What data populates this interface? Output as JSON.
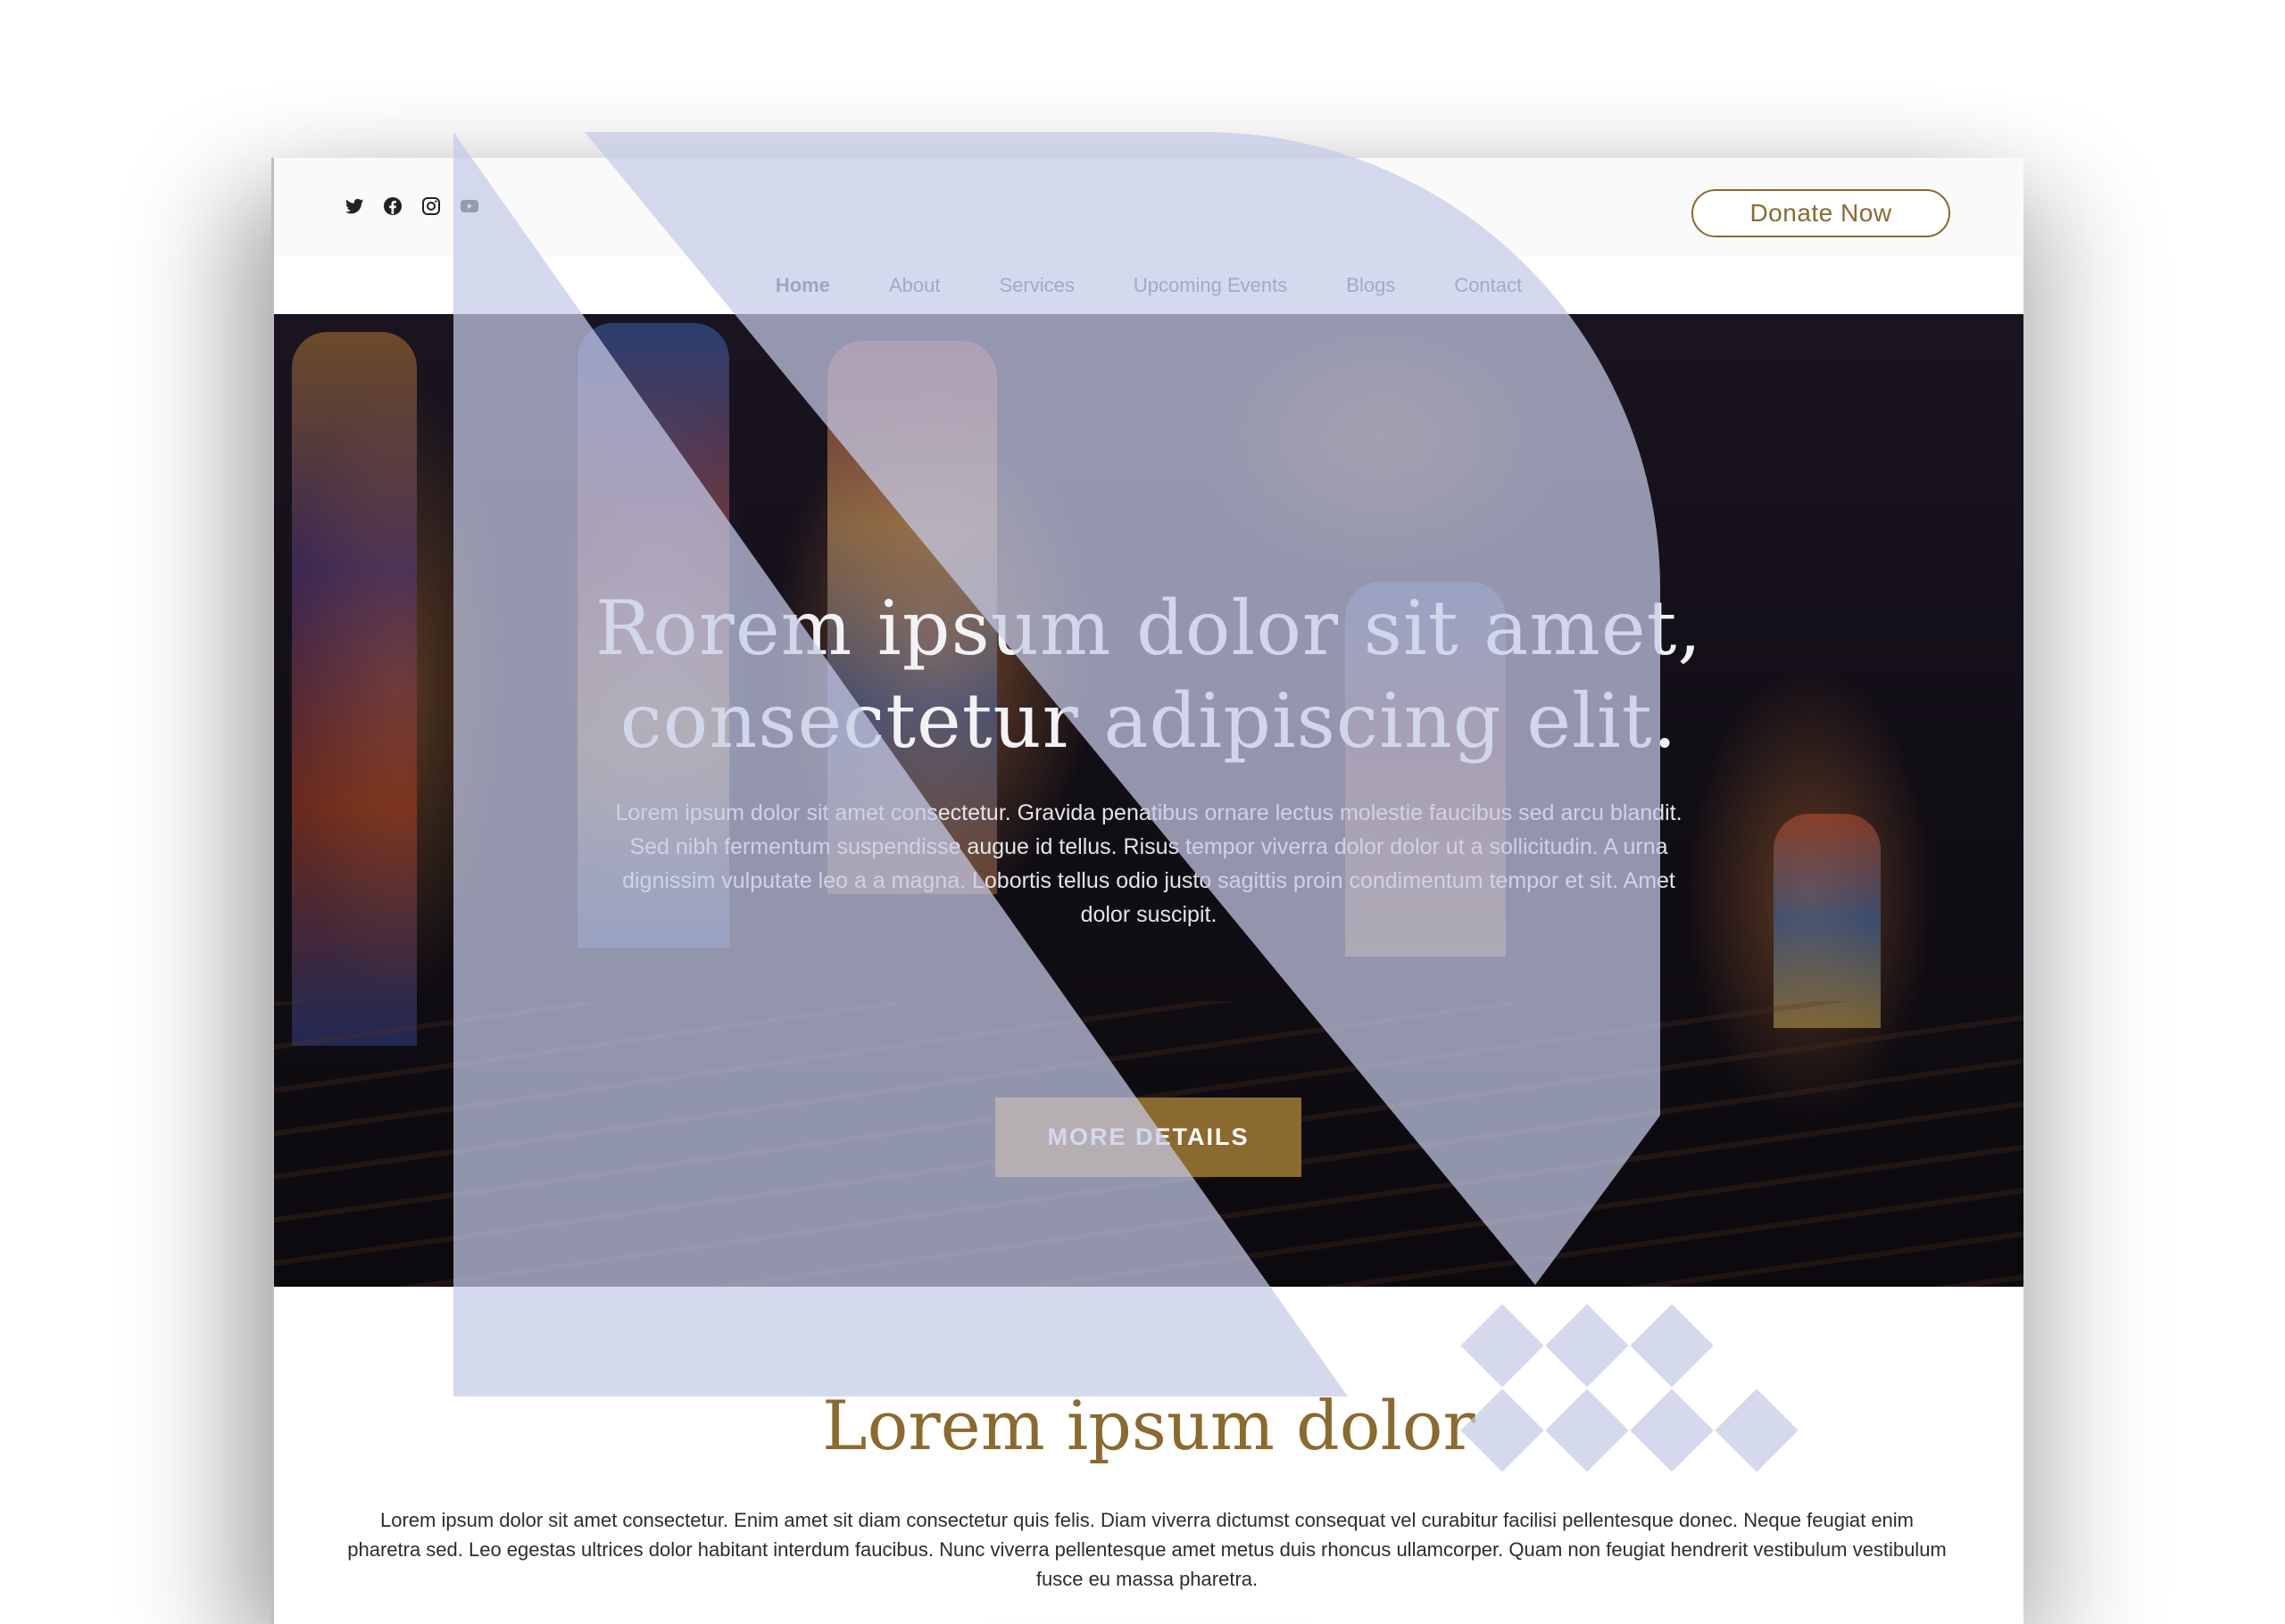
{
  "topbar": {
    "social_icons": [
      "twitter-icon",
      "facebook-icon",
      "instagram-icon",
      "youtube-icon"
    ],
    "donate_label": "Donate Now"
  },
  "nav": {
    "items": [
      {
        "label": "Home",
        "active": true
      },
      {
        "label": "About"
      },
      {
        "label": "Services"
      },
      {
        "label": "Upcoming Events"
      },
      {
        "label": "Blogs"
      },
      {
        "label": "Contact"
      }
    ]
  },
  "hero": {
    "title_line1": "Rorem ipsum dolor sit amet,",
    "title_line2": "consectetur adipiscing elit.",
    "text": "Lorem ipsum dolor sit amet consectetur. Gravida penatibus ornare lectus molestie faucibus sed arcu blandit. Sed nibh fermentum suspendisse augue id tellus. Risus tempor viverra dolor dolor ut a sollicitudin. A urna dignissim vulputate leo a a magna. Lobortis tellus odio justo sagittis proin condimentum tempor et sit. Amet dolor suscipit.",
    "button_label": "MORE DETAILS"
  },
  "section": {
    "title": "Lorem ipsum dolor",
    "text": "Lorem ipsum dolor sit amet consectetur. Enim amet sit diam consectetur quis felis. Diam viverra dictumst consequat vel curabitur facilisi pellentesque donec. Neque feugiat enim pharetra sed. Leo egestas ultrices dolor habitant interdum faucibus. Nunc viverra pellentesque amet metus duis rhoncus ullamcorper. Quam non feugiat hendrerit vestibulum vestibulum fusce eu massa pharetra."
  },
  "colors": {
    "accent_gold": "#8b6a2e",
    "overlay_shape": "#c5cbe8",
    "nav_text": "#4a5568"
  }
}
